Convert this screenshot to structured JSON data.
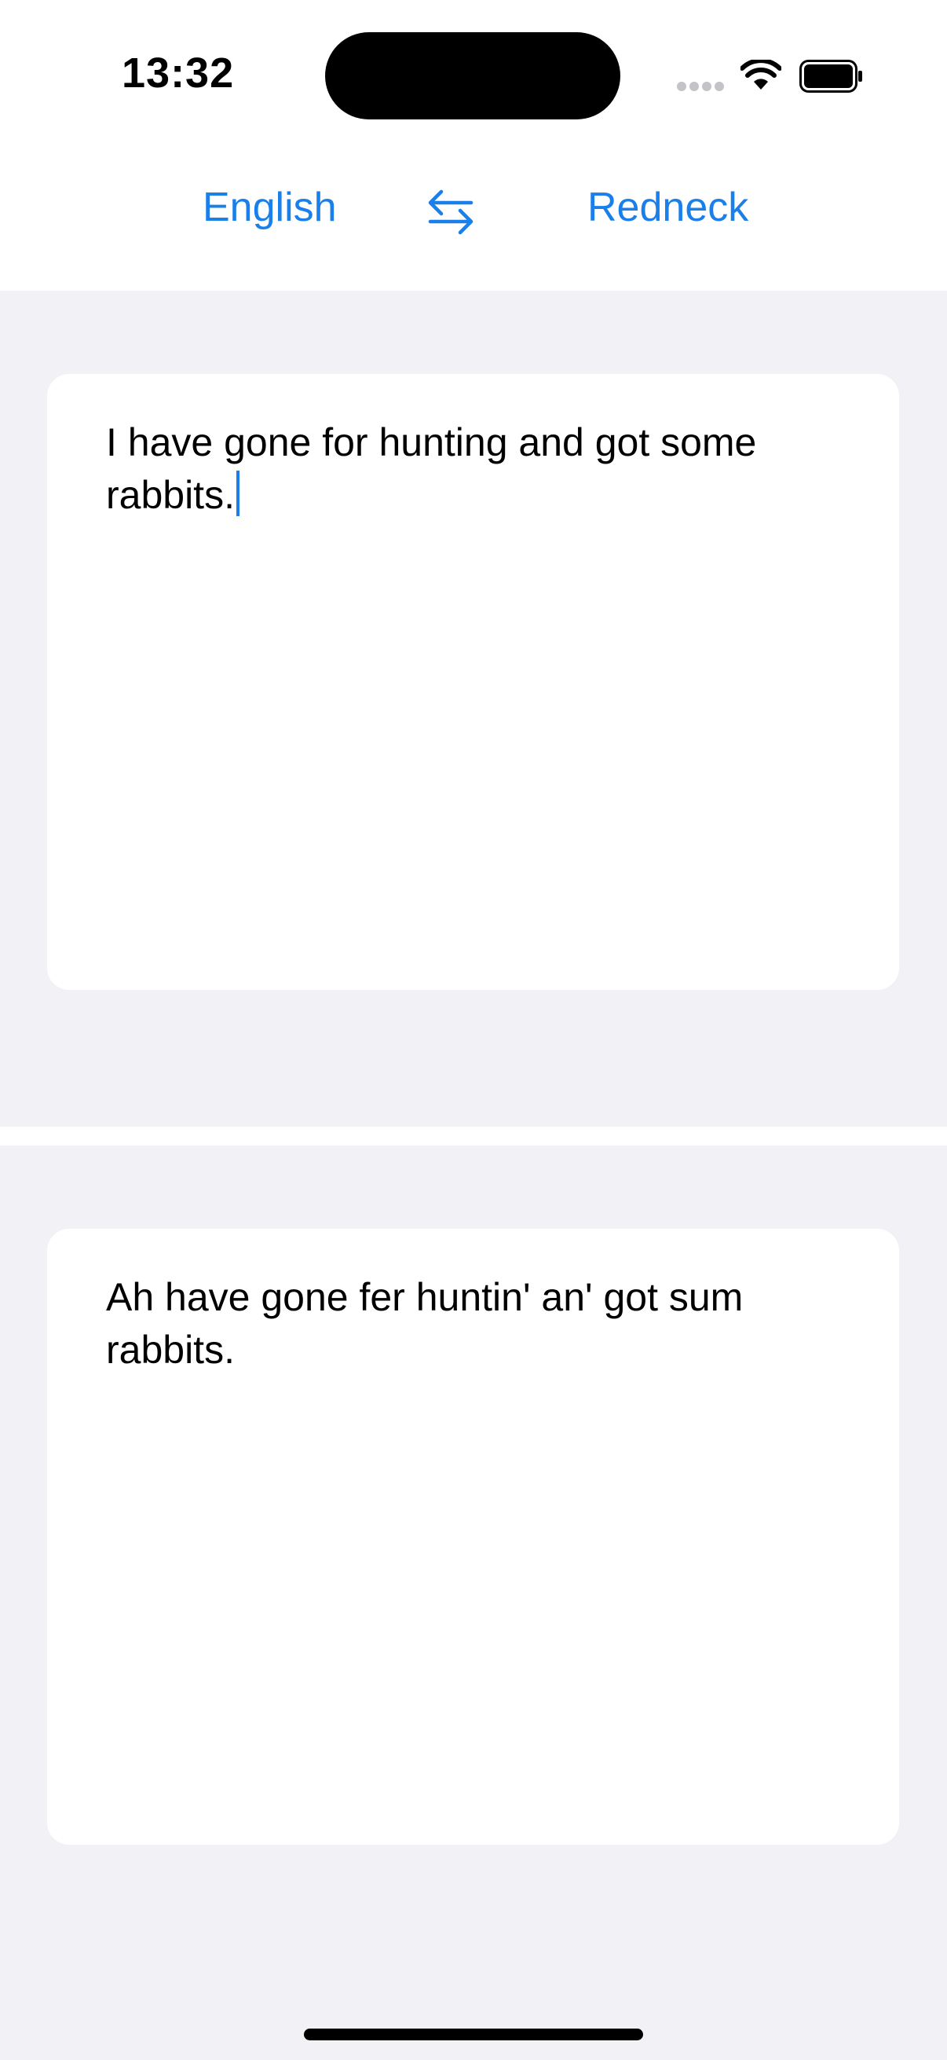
{
  "status_bar": {
    "time": "13:32"
  },
  "language_bar": {
    "source_language": "English",
    "target_language": "Redneck",
    "swap_icon": "arrow-left-right-icon"
  },
  "input": {
    "text": "I have gone for hunting and got some rabbits."
  },
  "output": {
    "text": "Ah have gone fer huntin' an' got sum rabbits."
  },
  "colors": {
    "accent": "#1a7fe8",
    "panel_background": "#f1f1f6",
    "card_background": "#ffffff"
  }
}
